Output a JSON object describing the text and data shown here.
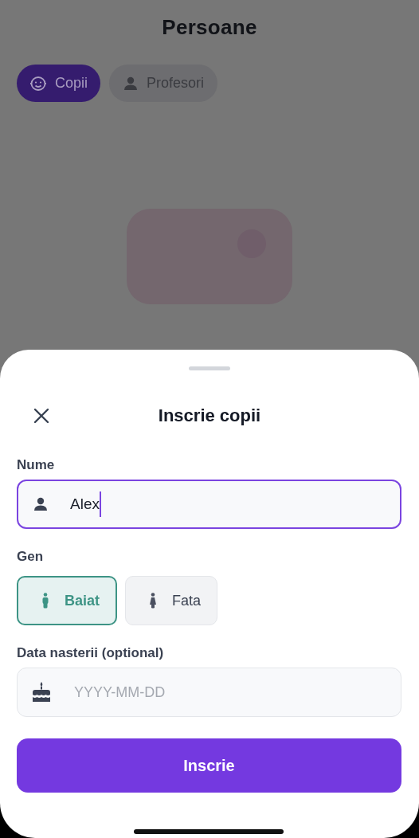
{
  "screen": {
    "title": "Persoane"
  },
  "tabs": [
    {
      "label": "Copii",
      "selected": true
    },
    {
      "label": "Profesori",
      "selected": false
    }
  ],
  "sheet": {
    "title": "Inscrie copii",
    "name": {
      "label": "Nume",
      "value": "Alex",
      "focused": true
    },
    "gender": {
      "label": "Gen",
      "options": [
        {
          "label": "Baiat",
          "selected": true
        },
        {
          "label": "Fata",
          "selected": false
        }
      ]
    },
    "birth_date": {
      "label": "Data nasterii (optional)",
      "placeholder": "YYYY-MM-DD"
    },
    "submit": "Inscrie"
  }
}
